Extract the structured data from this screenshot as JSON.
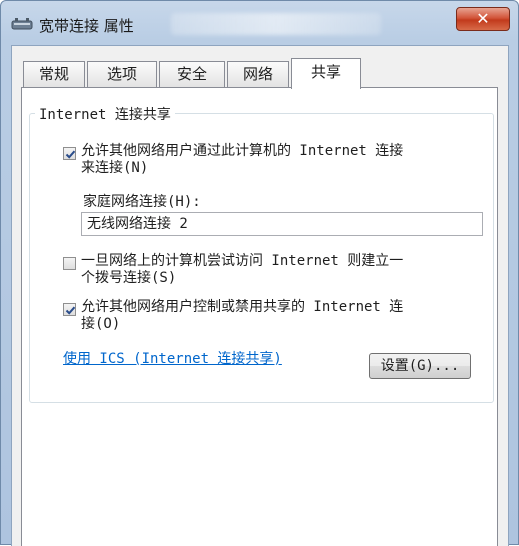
{
  "window": {
    "title": "宽带连接 属性",
    "close_label": "✕"
  },
  "tabs": [
    {
      "label": "常规",
      "active": false
    },
    {
      "label": "选项",
      "active": false
    },
    {
      "label": "安全",
      "active": false
    },
    {
      "label": "网络",
      "active": false
    },
    {
      "label": "共享",
      "active": true
    }
  ],
  "sharing": {
    "group_label": "Internet 连接共享",
    "allow_connect": {
      "checked": true,
      "line1": "允许其他网络用户通过此计算机的 Internet 连接",
      "line2": "来连接(N)"
    },
    "home_network_label": "家庭网络连接(H):",
    "home_network_value": "无线网络连接 2",
    "dial_on_demand": {
      "checked": false,
      "line1": "一旦网络上的计算机尝试访问 Internet 则建立一",
      "line2": "个拨号连接(S)"
    },
    "allow_control": {
      "checked": true,
      "line1": "允许其他网络用户控制或禁用共享的 Internet 连",
      "line2": "接(O)"
    },
    "ics_link": "使用 ICS (Internet 连接共享)",
    "settings_button": "设置(G)..."
  },
  "colors": {
    "link": "#0066cc",
    "close_button": "#c23a1c"
  },
  "icons": {
    "title": "network-connection-icon",
    "check": "checkmark-icon"
  }
}
